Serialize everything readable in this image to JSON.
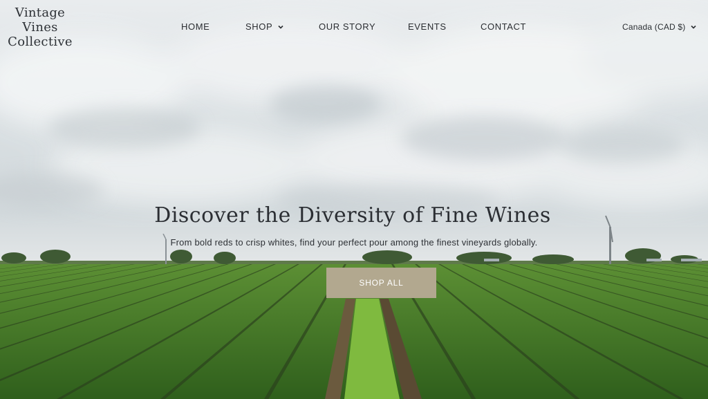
{
  "brand": {
    "name_line1": "Vintage",
    "name_line2": "Vines",
    "name_line3": "Collective"
  },
  "nav": {
    "items": [
      {
        "label": "HOME",
        "has_dropdown": false
      },
      {
        "label": "SHOP",
        "has_dropdown": true
      },
      {
        "label": "OUR STORY",
        "has_dropdown": false
      },
      {
        "label": "EVENTS",
        "has_dropdown": false
      },
      {
        "label": "CONTACT",
        "has_dropdown": false
      }
    ]
  },
  "currency": {
    "label": "Canada (CAD $)",
    "icon": "chevron-down-icon"
  },
  "hero": {
    "headline": "Discover the Diversity of Fine Wines",
    "subheadline": "From bold reds to crisp whites, find your perfect pour among the finest vineyards globally.",
    "cta_label": "SHOP ALL",
    "cta_color": "#b2a88f",
    "image": "vineyard-rows-under-cloudy-sky"
  },
  "colors": {
    "text": "#2b2e33",
    "vine_green": "#4f8a2b",
    "sky": "#dfe4e6"
  }
}
